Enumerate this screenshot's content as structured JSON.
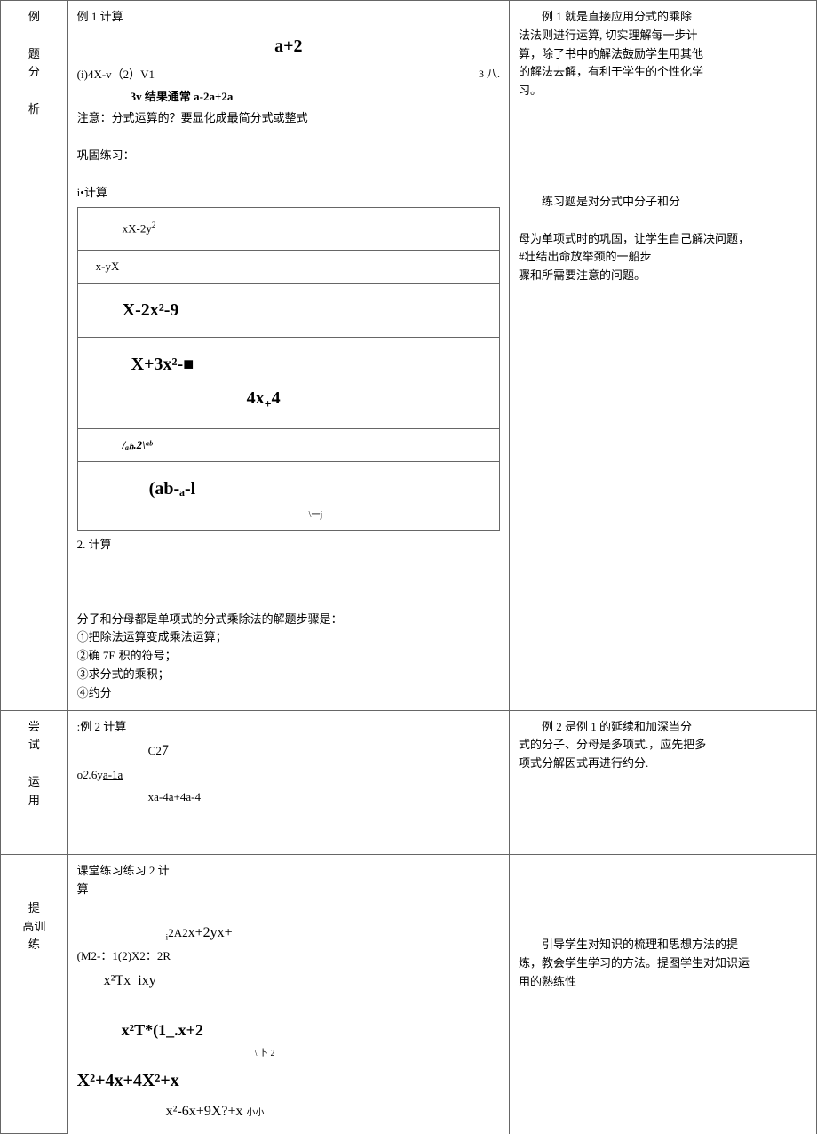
{
  "row1": {
    "label_lines": [
      "例",
      "题",
      "分",
      "析"
    ],
    "content": {
      "ex1_title": "例 1 计算",
      "f1": "a+2",
      "f2": "(i)4X-v（2）V1",
      "f2b": "3 八.",
      "f3": "3v 结果通常 a-2a+2a",
      "note_text": "注意：分式运算的？要显化成最简分式或整式",
      "practice_label": "巩固练习：",
      "calc1_label": "i•计算",
      "t1_r1": "xX-2y",
      "t1_r1_exp": "2",
      "t1_r2": "x-yX",
      "t1_r3": "X-2x²-9",
      "t1_r4a": "X+3x²-■",
      "t1_r4b": "4x+4",
      "t1_r5": "/ₐₕ.2\\ᵃᵇ",
      "t1_r6": "(ab-ₐ-l",
      "t1_r6b": "\\一j",
      "calc2_label": "2. 计算",
      "step_intro": "分子和分母都是单项式的分式乘除法的解题步骤是：",
      "step1": "①把除法运算变成乘法运算；",
      "step2": "②确 7E 积的符号；",
      "step3": "③求分式的乘积；",
      "step4": "④约分"
    },
    "note": {
      "p1_indent": "例 1 就是直接应用分式的乘除",
      "p1_l2": "法法则进行运算, 切实理解每一步计",
      "p1_l3": "算，除了书中的解法鼓励学生用其他",
      "p1_l4": "的解法去解，有利于学生的个性化学",
      "p1_l5": "习。",
      "p2_indent": "练习题是对分式中分子和分",
      "p2_l2": "母为单项式时的巩固，让学生自己解决问题，",
      "p2_l3": "#壮结出命放举颈的一船步",
      "p2_l4": "骤和所需要注意的问题。"
    }
  },
  "row2": {
    "label_lines": [
      "尝",
      "试",
      "运",
      "用"
    ],
    "content": {
      "title": ":例 2 计算",
      "f1": "C27",
      "f2": "o2.6ya-1a",
      "f3": "xa-4a+4a-4"
    },
    "note": {
      "p1_indent": "例 2 是例 1 的延续和加深当分",
      "p1_l2": "式的分子、分母是多项式.，应先把多",
      "p1_l3": "项式分解因式再进行约分."
    }
  },
  "row3": {
    "label_lines": [
      "提",
      "高训",
      "练"
    ],
    "content": {
      "title": "课堂练习练习 2 计",
      "title2": "算",
      "f1": "i2A2x+2yx+",
      "f2": "(M2-：1(2)X2：2R",
      "f3": "x²Tx_ixy",
      "f4": "x²T*(1_.x+2",
      "f4b": "\\ 卜 2",
      "f5": "X²+4x+4X²+x",
      "f6": "x²-6x+9X?+x 小小"
    },
    "note": {
      "p1_indent": "引导学生对知识的梳理和思想方法的提",
      "p1_l2": "炼，教会学生学习的方法。提图学生对知识运",
      "p1_l3": "用的熟练性"
    }
  }
}
